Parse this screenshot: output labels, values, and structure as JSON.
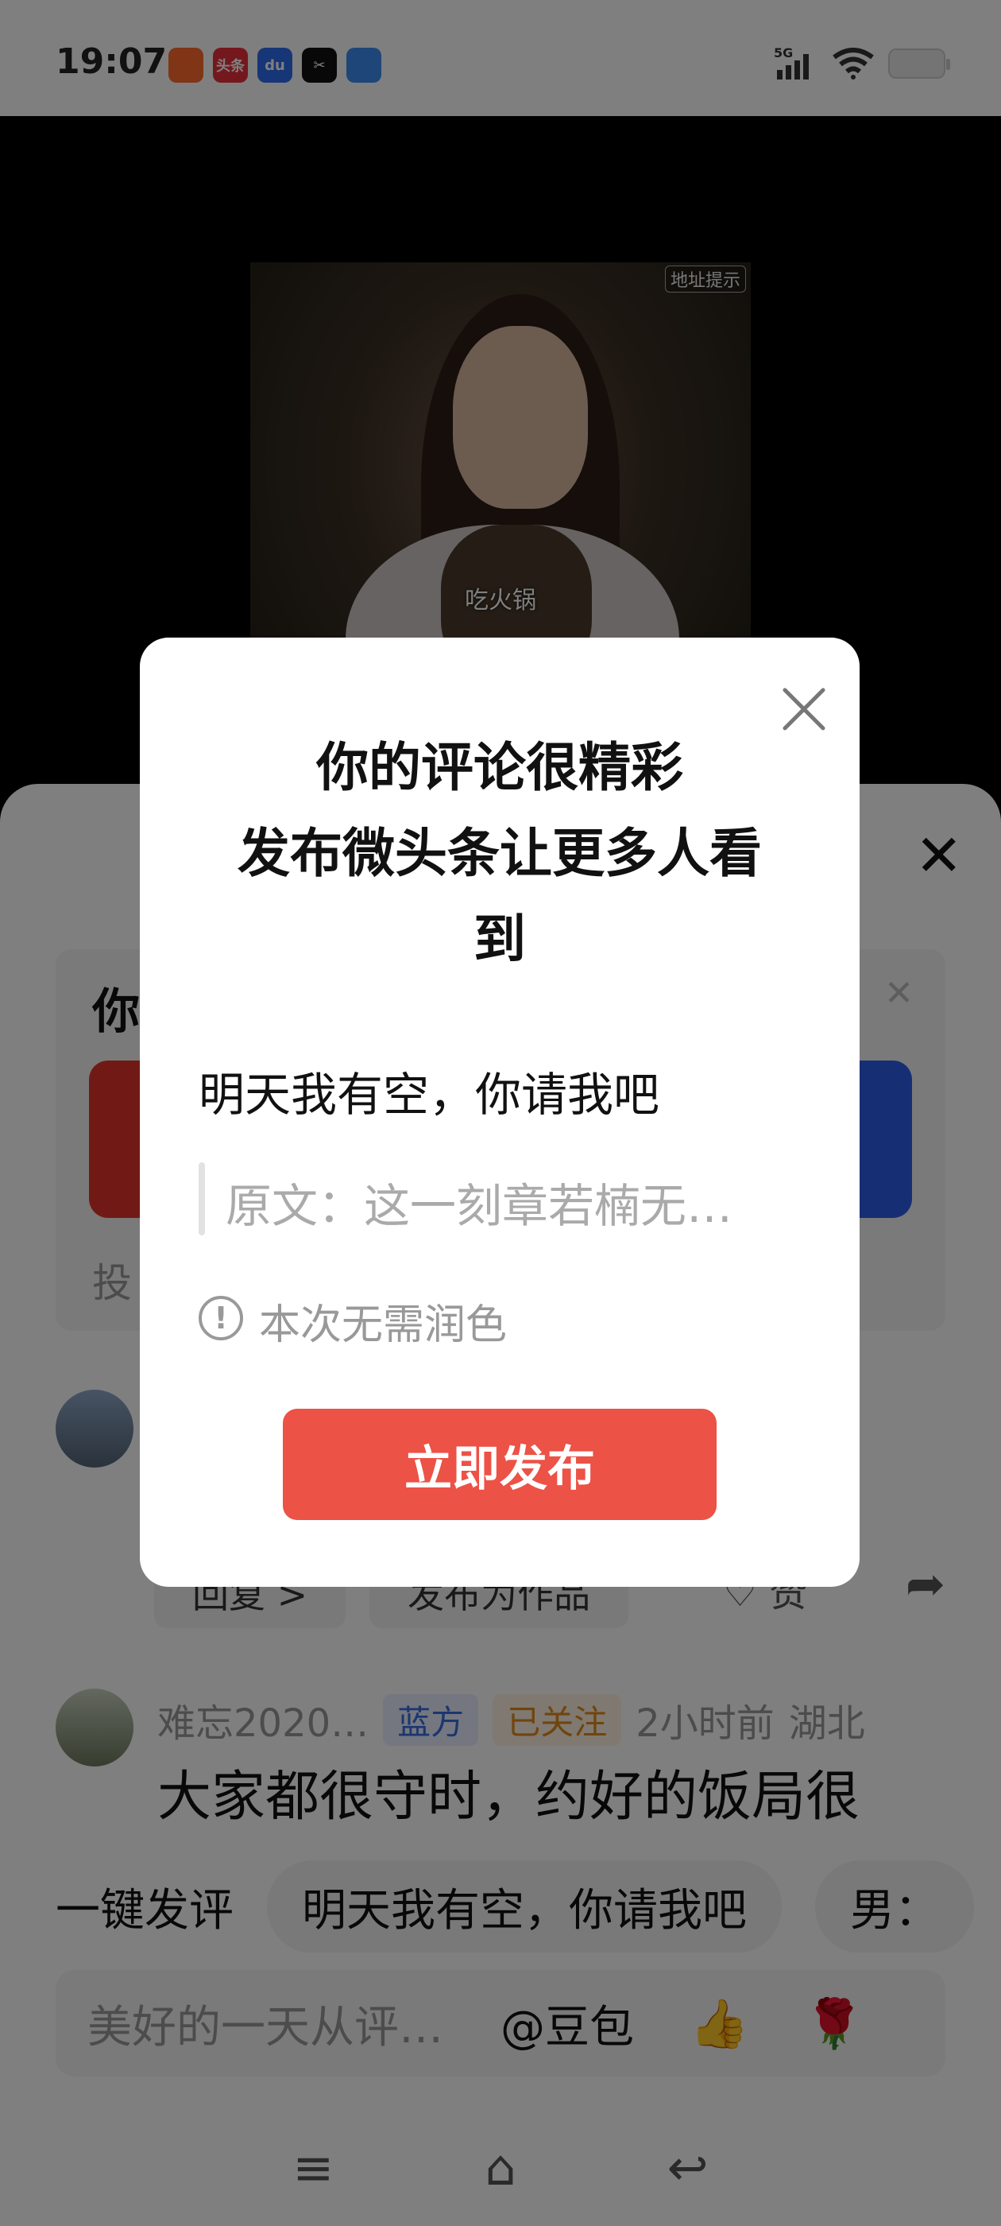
{
  "status_bar": {
    "time": "19:07",
    "apps": [
      {
        "icon": "kuaishou-icon",
        "label": "",
        "color": "#ff6a2c"
      },
      {
        "icon": "toutiao-icon",
        "label": "头条",
        "color": "#e8303a"
      },
      {
        "icon": "baidu-icon",
        "label": "du",
        "color": "#2f6cf0"
      },
      {
        "icon": "capcut-icon",
        "label": "✂",
        "color": "#111111"
      },
      {
        "icon": "files-icon",
        "label": "",
        "color": "#3c8cf0"
      }
    ],
    "network": "5G"
  },
  "video": {
    "watermark": "地址提示",
    "subtitle": "吃火锅"
  },
  "sheet": {
    "promo": {
      "title": "你",
      "vote_text": "投"
    },
    "comment1": {
      "reply_label": "回复 >",
      "publish_as_work_label": "发布为作品",
      "like_label": "赞"
    },
    "comment2": {
      "author": "难忘2020…",
      "tag_blue": "蓝方",
      "tag_follow": "已关注",
      "time": "2小时前",
      "location": "湖北",
      "text": "大家都很守时，约好的饭局很"
    },
    "quick_comment": {
      "label": "一键发评",
      "chips": [
        "明天我有空，你请我吧",
        "男："
      ]
    },
    "input": {
      "placeholder": "美好的一天从评…",
      "mention": "@豆包",
      "emoji1": "👍",
      "emoji2": "🌹"
    }
  },
  "dialog": {
    "title_line1": "你的评论很精彩",
    "title_line2": "发布微头条让更多人看",
    "title_line3": "到",
    "comment": "明天我有空，你请我吧",
    "original": "原文：这一刻章若楠无…",
    "hint": "本次无需润色",
    "publish_label": "立即发布"
  },
  "nav": {
    "menu": "≡",
    "home": "⌂",
    "back": "↩"
  },
  "colors": {
    "accent_red": "#ec5246",
    "blue": "#3a6de0"
  }
}
